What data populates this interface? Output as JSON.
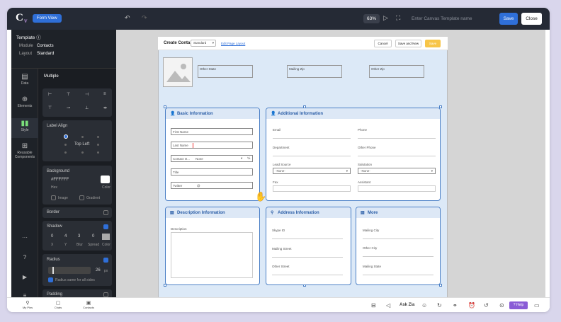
{
  "header": {
    "form_view_label": "Form View",
    "zoom": "63%",
    "template_name_placeholder": "Enter Canvas Template name",
    "save_label": "Save",
    "close_label": "Close"
  },
  "template": {
    "title": "Template",
    "module_label": "Module",
    "module_value": "Contacts",
    "layout_label": "Layout",
    "layout_value": "Standard"
  },
  "rail": [
    {
      "label": "Data"
    },
    {
      "label": "Elements"
    },
    {
      "label": "Style"
    },
    {
      "label": "Reusable Components"
    }
  ],
  "panel": {
    "mode": "Multiple",
    "label_align_title": "Label Align",
    "label_align_value": "Top Left",
    "background_title": "Background",
    "background_hex": "#FFFFFF",
    "hex_label": "Hex",
    "color_label": "Color",
    "image_label": "Image",
    "gradient_label": "Gradient",
    "border_title": "Border",
    "shadow_title": "Shadow",
    "shadow_values": [
      "0",
      "4",
      "3",
      "0"
    ],
    "shadow_axes": [
      "X",
      "Y",
      "Blur",
      "Spread"
    ],
    "shadow_color_label": "Color",
    "radius_title": "Radius",
    "radius_value": "26",
    "radius_unit": "px",
    "radius_same": "Radius same for all sides",
    "padding_title": "Padding"
  },
  "page": {
    "title": "Create Conta",
    "layout_select": "Standard",
    "edit_link": "Edit Page Layout",
    "cancel": "Cancel",
    "save_new": "Save and New",
    "save": "Save",
    "top_fields": [
      "Other State",
      "Mailing Zip",
      "Other Zip"
    ]
  },
  "sections": {
    "basic": {
      "title": "Basic Information",
      "fields": [
        "First Name",
        "Last Name",
        "Contact O...",
        "Title",
        "Twitter"
      ],
      "contact_owner_value": "None",
      "twitter_prefix": "@"
    },
    "additional": {
      "title": "Additional Information",
      "left": [
        "Email",
        "Department",
        "Lead Source",
        "Fax"
      ],
      "right": [
        "Phone",
        "Other Phone",
        "Salutation",
        "Assistant"
      ],
      "lead_source_value": "-None-",
      "salutation_value": "-None-"
    },
    "description": {
      "title": "Description Information",
      "field": "Description"
    },
    "address": {
      "title": "Address Information",
      "fields": [
        "Skype ID",
        "Mailing Street",
        "Other Street"
      ]
    },
    "more": {
      "title": "More",
      "fields": [
        "Mailing City",
        "Other City",
        "Mailing State"
      ]
    }
  },
  "bottom": {
    "apps": [
      "My Pins",
      "Chats",
      "Contacts"
    ],
    "ask_zia": "Ask Zia",
    "help": "Help"
  }
}
